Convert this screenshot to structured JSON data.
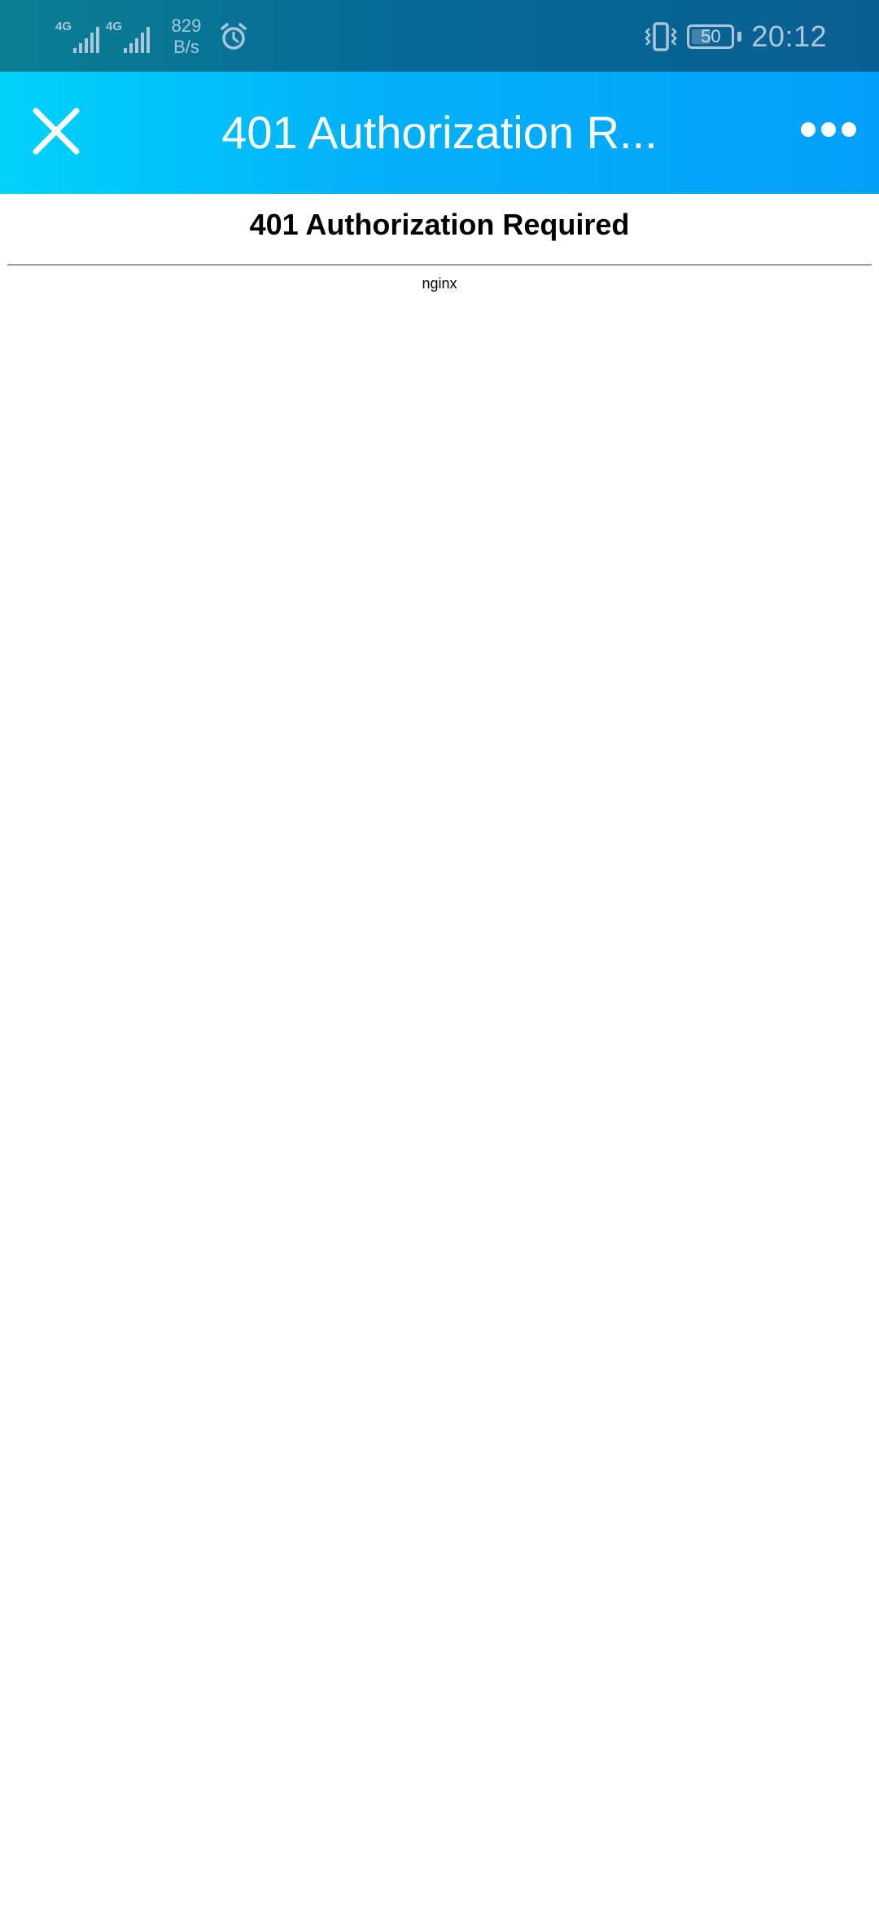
{
  "status_bar": {
    "signal_1_label": "4G",
    "signal_2_label": "4G",
    "net_speed_value": "829",
    "net_speed_unit": "B/s",
    "battery_level": "50",
    "time": "20:12",
    "icons": [
      "signal-icon",
      "signal-icon",
      "alarm-icon",
      "vibrate-icon",
      "battery-icon"
    ]
  },
  "app_bar": {
    "title": "401 Authorization R...",
    "close_icon": "close-icon",
    "more_icon": "more-icon"
  },
  "page": {
    "heading": "401 Authorization Required",
    "server": "nginx"
  },
  "colors": {
    "status_bar_bg": "#0a6f96",
    "app_bar_start": "#00d2fb",
    "app_bar_end": "#03a0fb",
    "status_text": "#a9c7d6"
  }
}
